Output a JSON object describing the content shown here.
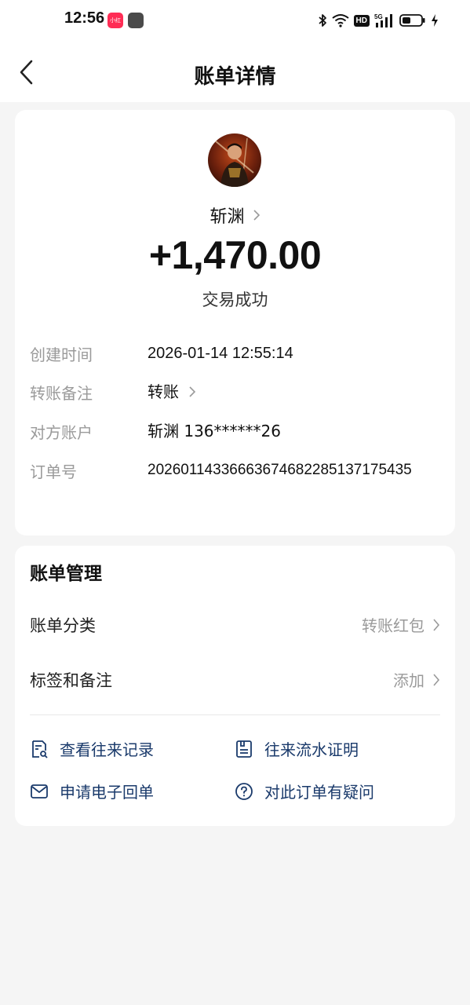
{
  "status_bar": {
    "time": "12:56",
    "app_badge": "小红书",
    "hd_label": "HD",
    "network_label": "5G"
  },
  "header": {
    "title": "账单详情"
  },
  "transaction": {
    "payee_name": "斩渊",
    "amount": "+1,470.00",
    "status": "交易成功",
    "details": [
      {
        "label": "创建时间",
        "value": "2026-01-14 12:55:14"
      },
      {
        "label": "转账备注",
        "value": "转账"
      },
      {
        "label": "对方账户",
        "value": "斩渊 136******26"
      },
      {
        "label": "订单号",
        "value": "20260114336663674682285137175435"
      }
    ]
  },
  "manage": {
    "title": "账单管理",
    "category_label": "账单分类",
    "category_value": "转账红包",
    "tags_label": "标签和备注",
    "tags_value": "添加",
    "actions": [
      {
        "label": "查看往来记录",
        "icon": "search-record-icon"
      },
      {
        "label": "往来流水证明",
        "icon": "document-icon"
      },
      {
        "label": "申请电子回单",
        "icon": "mail-icon"
      },
      {
        "label": "对此订单有疑问",
        "icon": "question-icon"
      }
    ]
  },
  "colors": {
    "background": "#f5f5f5",
    "card": "#ffffff",
    "action_text": "#1a3a6b",
    "muted_text": "#9a9a9a"
  }
}
